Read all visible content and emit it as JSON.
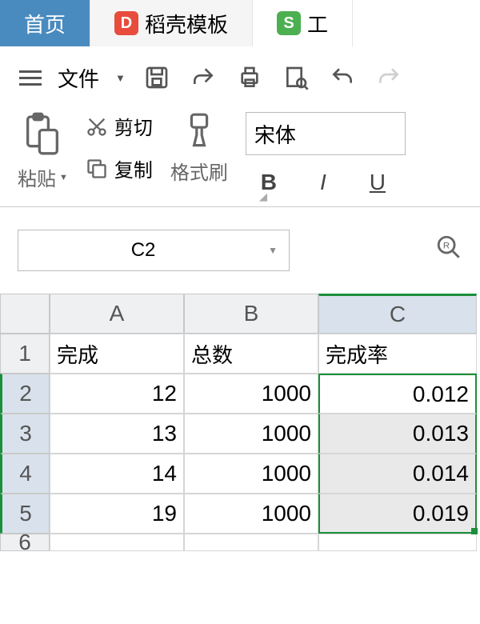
{
  "tabs": {
    "home": "首页",
    "template": "稻壳模板",
    "workspace": "工"
  },
  "file": {
    "label": "文件"
  },
  "clipboard": {
    "paste": "粘贴",
    "cut": "剪切",
    "copy": "复制",
    "format_painter": "格式刷"
  },
  "font": {
    "name": "宋体",
    "bold": "B",
    "italic": "I",
    "underline": "U"
  },
  "namebox": {
    "cell": "C2"
  },
  "columns": {
    "a": "A",
    "b": "B",
    "c": "C"
  },
  "rows": [
    "1",
    "2",
    "3",
    "4",
    "5",
    "6"
  ],
  "headers": {
    "a": "完成",
    "b": "总数",
    "c": "完成率"
  },
  "data": [
    {
      "a": "12",
      "b": "1000",
      "c": "0.012"
    },
    {
      "a": "13",
      "b": "1000",
      "c": "0.013"
    },
    {
      "a": "14",
      "b": "1000",
      "c": "0.014"
    },
    {
      "a": "19",
      "b": "1000",
      "c": "0.019"
    }
  ],
  "chart_data": {
    "type": "table",
    "columns": [
      "完成",
      "总数",
      "完成率"
    ],
    "rows": [
      [
        12,
        1000,
        0.012
      ],
      [
        13,
        1000,
        0.013
      ],
      [
        14,
        1000,
        0.014
      ],
      [
        19,
        1000,
        0.019
      ]
    ]
  }
}
